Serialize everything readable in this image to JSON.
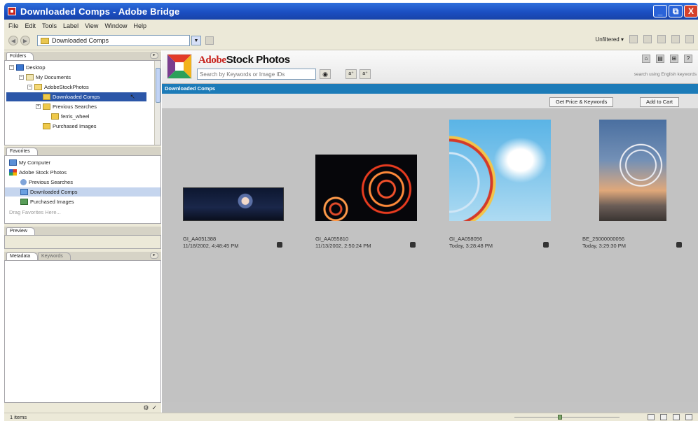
{
  "window": {
    "title": "Downloaded Comps - Adobe Bridge",
    "buttons": [
      "_",
      "⧉",
      "X"
    ]
  },
  "menu": [
    "File",
    "Edit",
    "Tools",
    "Label",
    "View",
    "Window",
    "Help"
  ],
  "toolbar": {
    "path": "Downloaded Comps",
    "filter_label": "Unfiltered ▾"
  },
  "folders_panel": {
    "tab": "Folders",
    "items": [
      {
        "label": "Desktop",
        "icon": "desktop-icon"
      },
      {
        "label": "My Documents",
        "icon": "documents-icon"
      },
      {
        "label": "AdobeStockPhotos",
        "icon": "folder-icon"
      },
      {
        "label": "Downloaded Comps",
        "icon": "folder-icon",
        "selected": true
      },
      {
        "label": "Previous Searches",
        "icon": "folder-icon"
      },
      {
        "label": "ferris_wheel",
        "icon": "folder-icon"
      },
      {
        "label": "Purchased Images",
        "icon": "folder-icon"
      }
    ]
  },
  "favorites_panel": {
    "tab": "Favorites",
    "items": [
      {
        "label": "My Computer",
        "icon": "computer-icon"
      },
      {
        "label": "Adobe Stock Photos",
        "icon": "stock-photos-icon"
      },
      {
        "label": "Previous Searches",
        "icon": "search-icon"
      },
      {
        "label": "Downloaded Comps",
        "icon": "comps-icon",
        "selected": true
      },
      {
        "label": "Purchased Images",
        "icon": "purchased-icon"
      }
    ],
    "drag_hint": "Drag Favorites Here..."
  },
  "preview_panel": {
    "tab": "Preview"
  },
  "metadata_panel": {
    "tabs": [
      "Metadata",
      "Keywords"
    ]
  },
  "stock": {
    "brand_adobe": "Adobe",
    "brand_stock": "Stock Photos",
    "search_placeholder": "Search by Keywords or Image IDs",
    "search_hint": "search using English keywords",
    "section": "Downloaded Comps",
    "buttons": {
      "get_price": "Get Price & Keywords",
      "add_to_cart": "Add to Cart"
    }
  },
  "thumbnails": [
    {
      "id": "GI_AA051388",
      "date": "11/18/2002, 4:48:45 PM"
    },
    {
      "id": "GI_AA055810",
      "date": "11/13/2002, 2:50:24 PM"
    },
    {
      "id": "GI_AA058056",
      "date": "Today, 3:28:48 PM"
    },
    {
      "id": "BE_25000000056",
      "date": "Today, 3:29:30 PM"
    }
  ],
  "status": {
    "items": "1 items"
  },
  "colors": {
    "titlebar": "#1b4fc2",
    "accent_strip": "#1c7bb8",
    "selection": "#2b56a8",
    "content_bg": "#c2c2c2"
  }
}
